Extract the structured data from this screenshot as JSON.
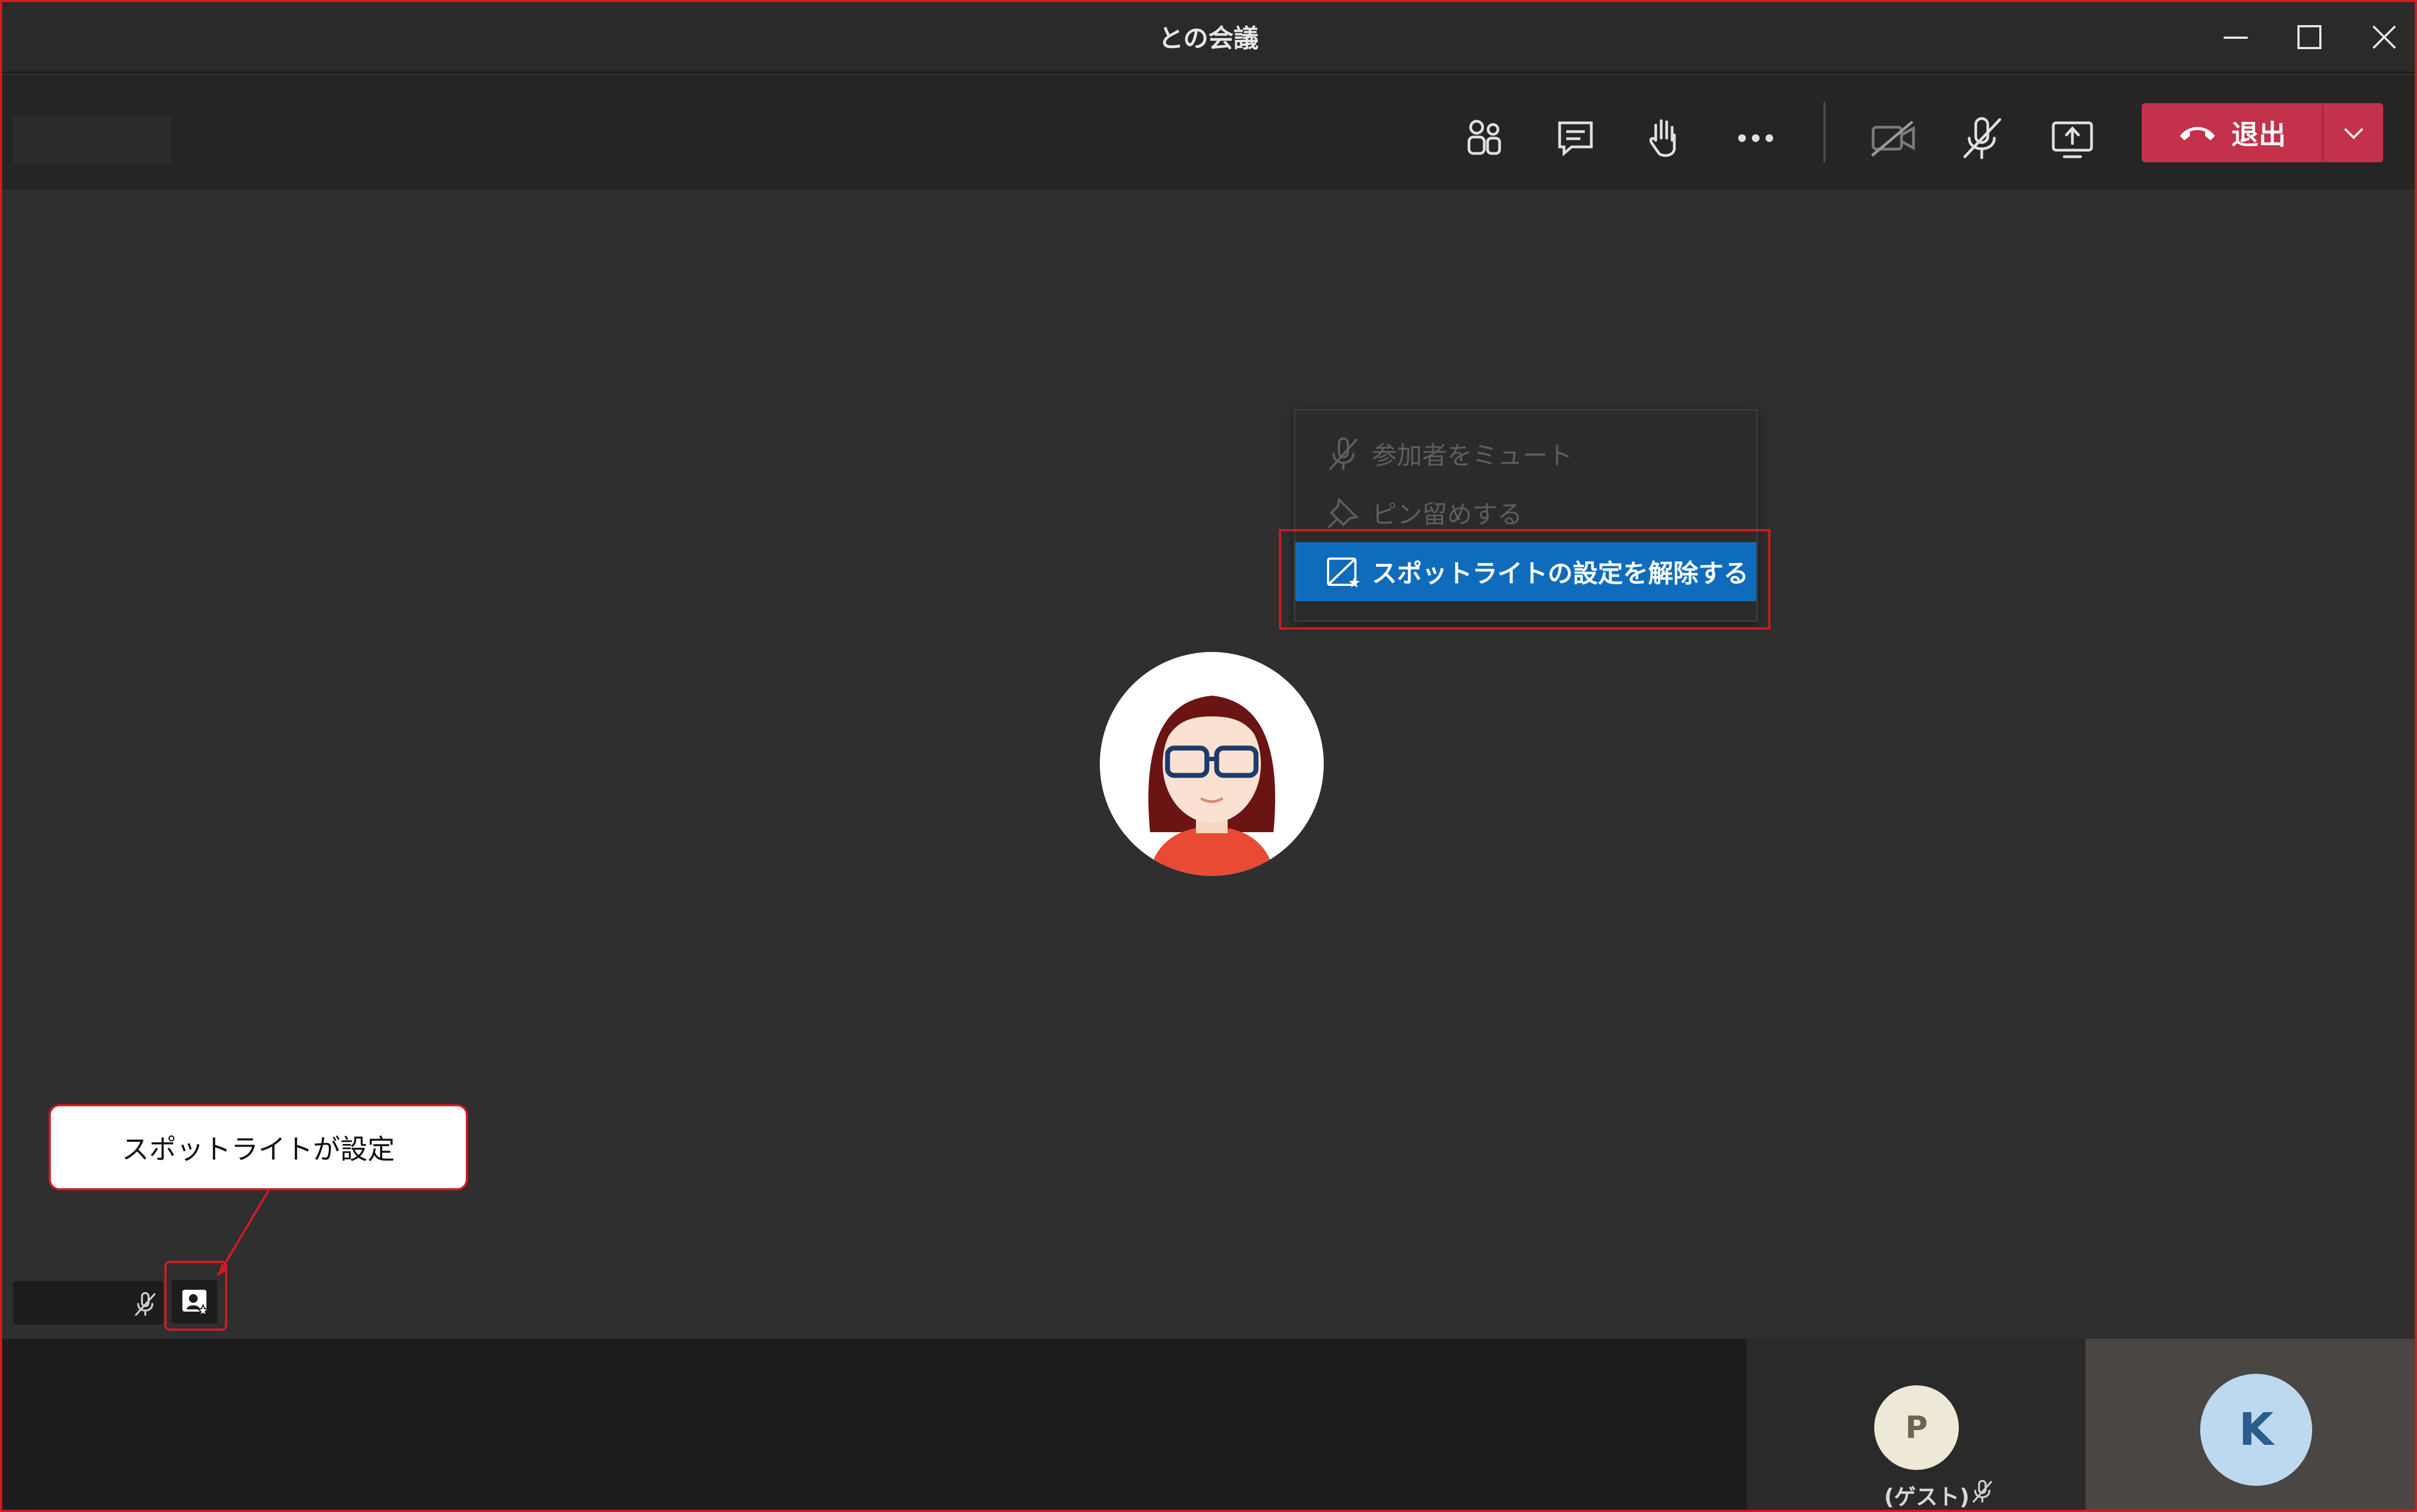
{
  "window": {
    "title": "との会議",
    "buttons": {
      "minimize": "minimize-icon",
      "maximize": "maximize-icon",
      "close": "close-icon"
    }
  },
  "toolbar": {
    "icons": [
      "people-icon",
      "chat-icon",
      "raise-hand-icon",
      "more-icon",
      "camera-off-icon",
      "mic-off-icon",
      "share-screen-icon"
    ],
    "leave_label": "退出",
    "leave_color": "#c4314b"
  },
  "context_menu": {
    "items": [
      {
        "label": "参加者をミュート",
        "icon": "mic-off-icon",
        "enabled": false
      },
      {
        "label": "ピン留めする",
        "icon": "pin-icon",
        "enabled": false
      },
      {
        "label": "スポットライトの設定を解除する",
        "icon": "spotlight-icon",
        "enabled": true,
        "highlighted": true
      }
    ],
    "highlight_color": "#0f6cbd"
  },
  "callout": {
    "text": "スポットライトが設定"
  },
  "participants": {
    "p": {
      "initial": "P",
      "name": "(ゲスト)"
    },
    "k": {
      "initial": "K"
    }
  },
  "annotation_color": "#d21a24"
}
